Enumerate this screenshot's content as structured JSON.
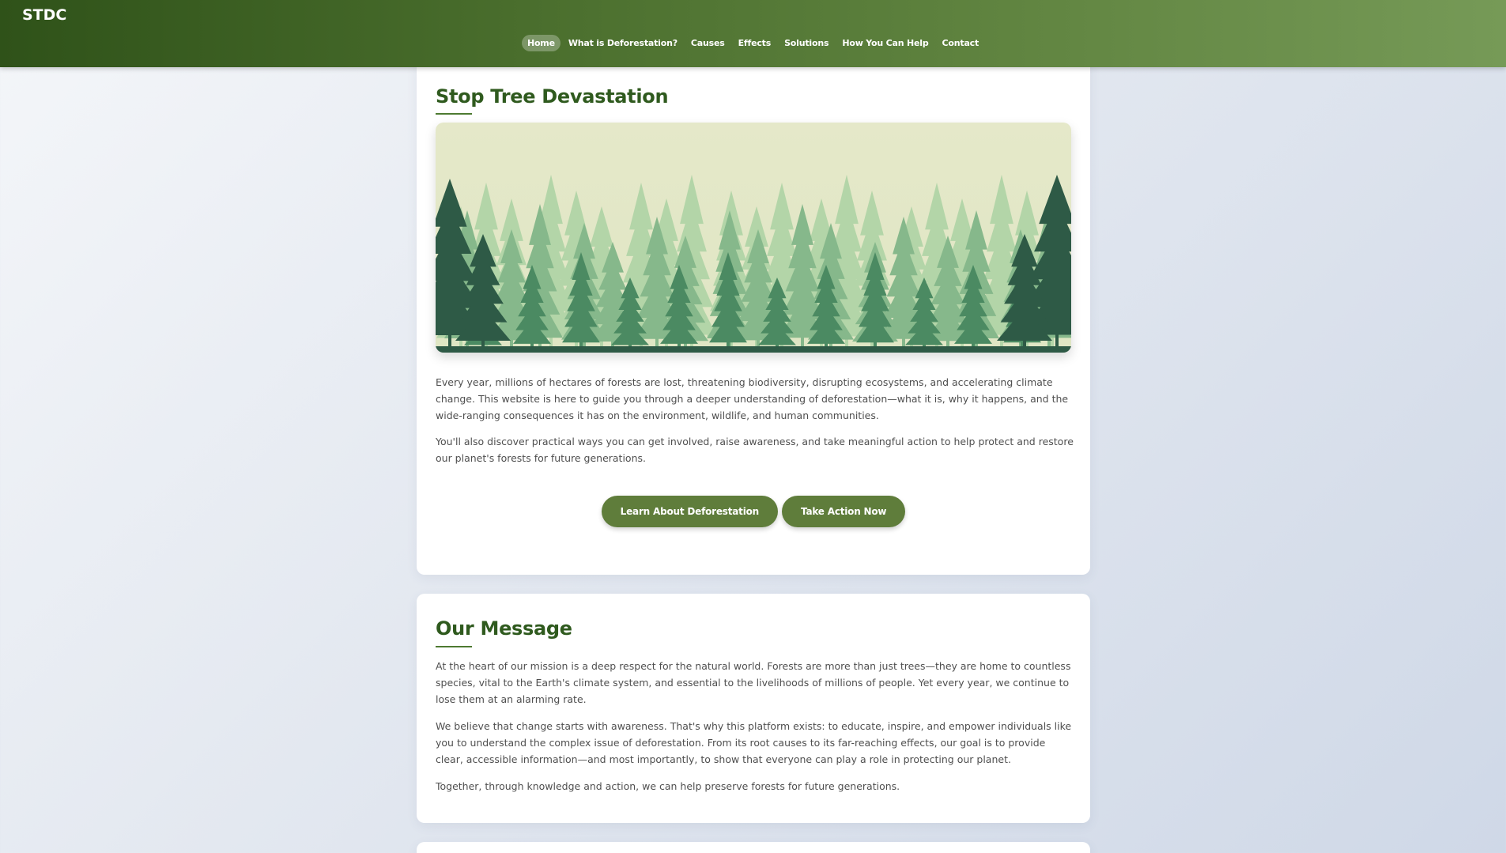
{
  "header": {
    "logo": "STDC",
    "nav": [
      {
        "label": "Home",
        "active": true
      },
      {
        "label": "What is Deforestation?"
      },
      {
        "label": "Causes"
      },
      {
        "label": "Effects"
      },
      {
        "label": "Solutions"
      },
      {
        "label": "How You Can Help"
      },
      {
        "label": "Contact"
      }
    ]
  },
  "hero_section": {
    "title": "Stop Tree Devastation",
    "paragraphs": [
      "Every year, millions of hectares of forests are lost, threatening biodiversity, disrupting ecosystems, and accelerating climate change. This website is here to guide you through a deeper understanding of deforestation—what it is, why it happens, and the wide-ranging consequences it has on the environment, wildlife, and human communities.",
      "You'll also discover practical ways you can get involved, raise awareness, and take meaningful action to help protect and restore our planet's forests for future generations."
    ],
    "buttons": {
      "learn": "Learn About Deforestation",
      "action": "Take Action Now"
    }
  },
  "message_section": {
    "title": "Our Message",
    "paragraphs": [
      "At the heart of our mission is a deep respect for the natural world. Forests are more than just trees—they are home to countless species, vital to the Earth's climate system, and essential to the livelihoods of millions of people. Yet every year, we continue to lose them at an alarming rate.",
      "We believe that change starts with awareness. That's why this platform exists: to educate, inspire, and empower individuals like you to understand the complex issue of deforestation. From its root causes to its far-reaching effects, our goal is to provide clear, accessible information—and most importantly, to show that everyone can play a role in protecting our planet.",
      "Together, through knowledge and action, we can help preserve forests for future generations."
    ]
  },
  "colors": {
    "header_start": "#2f5219",
    "header_end": "#769a57",
    "heading": "#2f5a1e",
    "button": "#5f7d3b"
  }
}
